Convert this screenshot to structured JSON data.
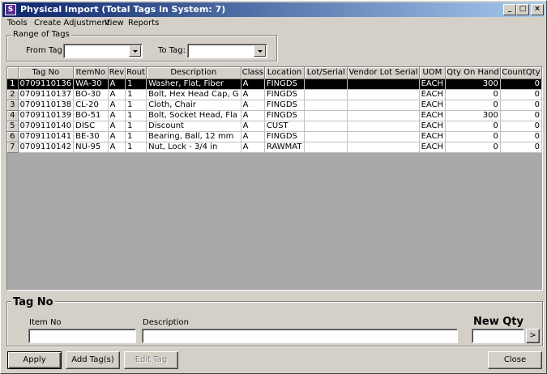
{
  "window": {
    "title": "Physical Import  (Total Tags in System: 7)",
    "app_icon": "S",
    "controls": {
      "minimize": "_",
      "maximize": "□",
      "close": "×"
    }
  },
  "menu": [
    "Tools",
    "Create Adjustment",
    "View",
    "Reports"
  ],
  "range": {
    "legend": "Range of Tags",
    "from_label": "From Tag:",
    "from_value": "",
    "to_label": "To Tag:",
    "to_value": ""
  },
  "grid": {
    "columns": [
      "Tag No",
      "ItemNo",
      "Rev",
      "Rout",
      "Description",
      "Class",
      "Location",
      "Lot/Serial",
      "Vendor Lot Serial",
      "UOM",
      "Qty On Hand",
      "CountQty"
    ],
    "rows": [
      {
        "num": "1",
        "cells": [
          "0709110136",
          "WA-30",
          "A",
          "1",
          "Washer, Flat, Fiber",
          "A",
          "FINGDS",
          "",
          "",
          "EACH",
          "300",
          "0"
        ],
        "selected": true
      },
      {
        "num": "2",
        "cells": [
          "0709110137",
          "BO-30",
          "A",
          "1",
          "Bolt, Hex Head Cap, G",
          "A",
          "FINGDS",
          "",
          "",
          "EACH",
          "0",
          "0"
        ],
        "selected": false
      },
      {
        "num": "3",
        "cells": [
          "0709110138",
          "CL-20",
          "A",
          "1",
          "Cloth, Chair",
          "A",
          "FINGDS",
          "",
          "",
          "EACH",
          "0",
          "0"
        ],
        "selected": false
      },
      {
        "num": "4",
        "cells": [
          "0709110139",
          "BO-51",
          "A",
          "1",
          "Bolt, Socket Head, Fla",
          "A",
          "FINGDS",
          "",
          "",
          "EACH",
          "300",
          "0"
        ],
        "selected": false
      },
      {
        "num": "5",
        "cells": [
          "0709110140",
          "DISC",
          "A",
          "1",
          "Discount",
          "A",
          "CUST",
          "",
          "",
          "EACH",
          "0",
          "0"
        ],
        "selected": false
      },
      {
        "num": "6",
        "cells": [
          "0709110141",
          "BE-30",
          "A",
          "1",
          "Bearing, Ball, 12 mm",
          "A",
          "FINGDS",
          "",
          "",
          "EACH",
          "0",
          "0"
        ],
        "selected": false
      },
      {
        "num": "7",
        "cells": [
          "0709110142",
          "NU-95",
          "A",
          "1",
          "Nut, Lock - 3/4 in",
          "A",
          "RAWMAT",
          "",
          "",
          "EACH",
          "0",
          "0"
        ],
        "selected": false
      }
    ]
  },
  "detail": {
    "legend": "Tag No",
    "item_no_label": "Item No",
    "item_no_value": "",
    "description_label": "Description",
    "description_value": "",
    "new_qty_label": "New Qty",
    "new_qty_value": "",
    "arrow_button": ">"
  },
  "buttons": {
    "apply": "Apply",
    "add_tags": "Add Tag(s)",
    "edit_tag": "Edit Tag",
    "close": "Close"
  }
}
